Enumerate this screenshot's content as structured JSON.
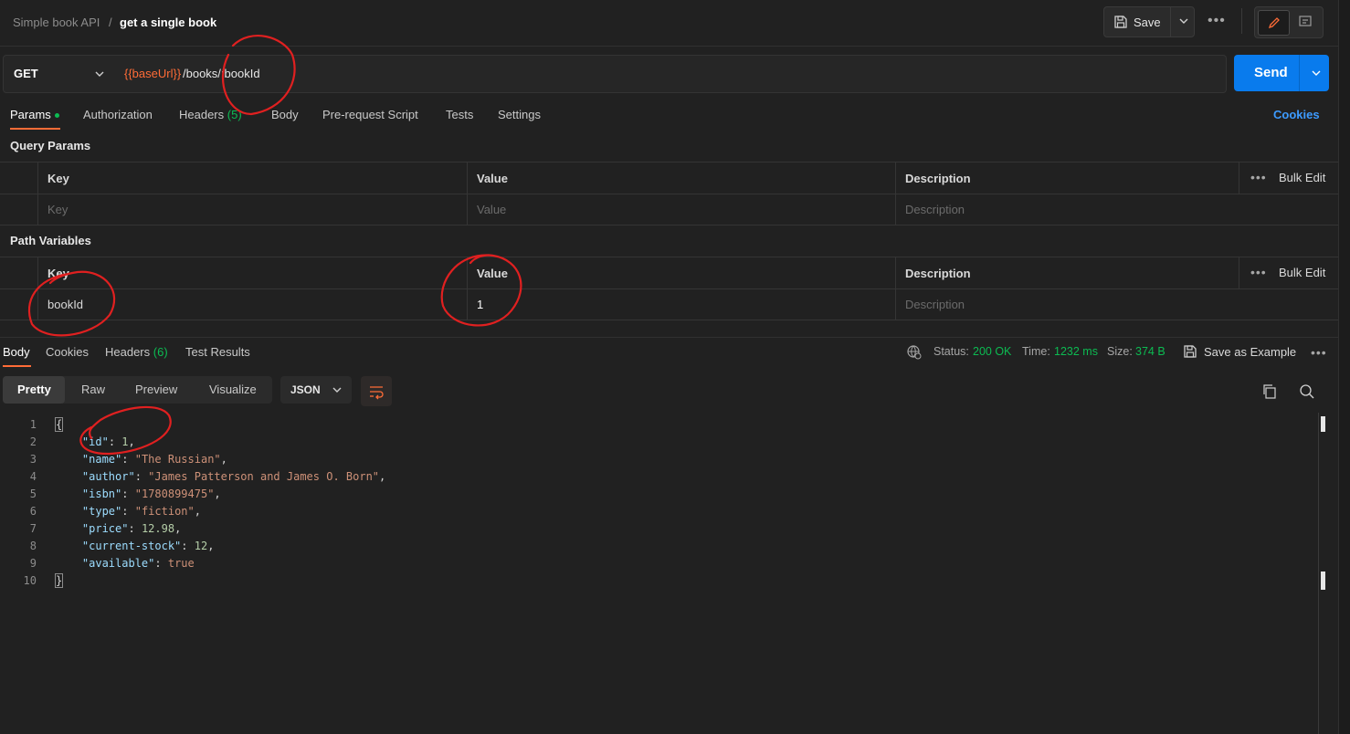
{
  "header": {
    "collection": "Simple book API",
    "separator": "/",
    "request_name": "get a single book",
    "save_label": "Save"
  },
  "request": {
    "method": "GET",
    "url_variable": "{{baseUrl}}",
    "url_path": "/books/:bookId",
    "send_label": "Send"
  },
  "request_tabs": {
    "params": "Params",
    "authorization": "Authorization",
    "headers": "Headers",
    "headers_count": "(5)",
    "body": "Body",
    "prerequest": "Pre-request Script",
    "tests": "Tests",
    "settings": "Settings",
    "cookies": "Cookies"
  },
  "query_params": {
    "title": "Query Params",
    "col_key": "Key",
    "col_value": "Value",
    "col_description": "Description",
    "bulk_edit": "Bulk Edit",
    "ph_key": "Key",
    "ph_value": "Value",
    "ph_description": "Description"
  },
  "path_variables": {
    "title": "Path Variables",
    "col_key": "Key",
    "col_value": "Value",
    "col_description": "Description",
    "bulk_edit": "Bulk Edit",
    "row_key": "bookId",
    "row_value": "1",
    "ph_description": "Description"
  },
  "response": {
    "tab_body": "Body",
    "tab_cookies": "Cookies",
    "tab_headers": "Headers",
    "headers_count": "(6)",
    "tab_tests": "Test Results",
    "status_label": "Status:",
    "status_value": "200 OK",
    "time_label": "Time:",
    "time_value": "1232 ms",
    "size_label": "Size:",
    "size_value": "374 B",
    "save_example": "Save as Example",
    "view_pretty": "Pretty",
    "view_raw": "Raw",
    "view_preview": "Preview",
    "view_visualize": "Visualize",
    "format": "JSON"
  },
  "body_json": {
    "line_numbers": [
      "1",
      "2",
      "3",
      "4",
      "5",
      "6",
      "7",
      "8",
      "9",
      "10"
    ],
    "id_key": "\"id\"",
    "id_val": "1",
    "name_key": "\"name\"",
    "name_val": "\"The Russian\"",
    "author_key": "\"author\"",
    "author_val": "\"James Patterson and James O. Born\"",
    "isbn_key": "\"isbn\"",
    "isbn_val": "\"1780899475\"",
    "type_key": "\"type\"",
    "type_val": "\"fiction\"",
    "price_key": "\"price\"",
    "price_val": "12.98",
    "stock_key": "\"current-stock\"",
    "stock_val": "12",
    "available_key": "\"available\"",
    "available_val": "true",
    "open_brace": "{",
    "close_brace": "}"
  },
  "colors": {
    "accent": "#ff6c37",
    "send_button": "#097bed",
    "status_ok": "#0cbb52",
    "link": "#3d9bff",
    "annotation": "#e02020"
  }
}
